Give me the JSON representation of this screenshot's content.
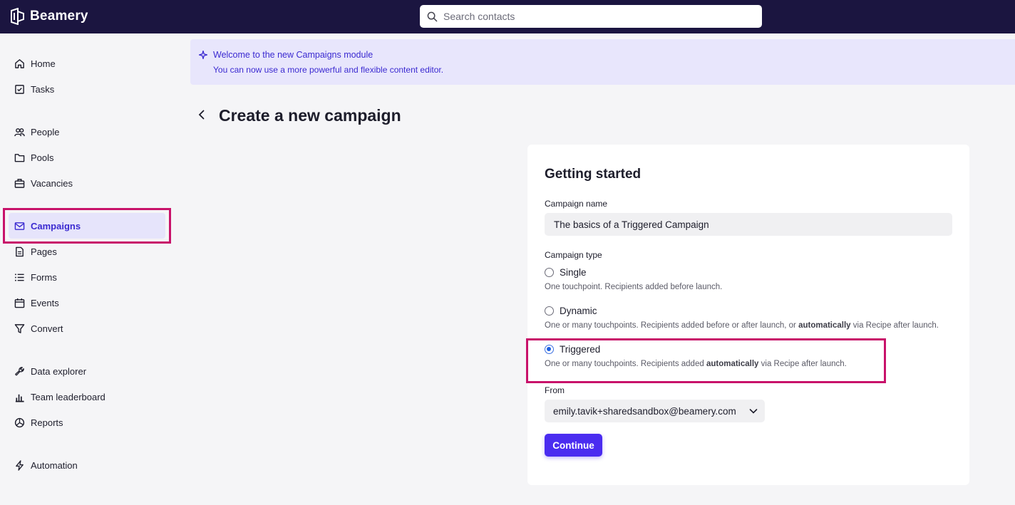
{
  "app": {
    "brand_name": "Beamery"
  },
  "search": {
    "placeholder": "Search contacts"
  },
  "sidebar": {
    "items": [
      {
        "label": "Home",
        "icon": "home-icon"
      },
      {
        "label": "Tasks",
        "icon": "tasks-icon"
      },
      {
        "label": "People",
        "icon": "people-icon"
      },
      {
        "label": "Pools",
        "icon": "folder-icon"
      },
      {
        "label": "Vacancies",
        "icon": "briefcase-icon"
      },
      {
        "label": "Campaigns",
        "icon": "mail-icon",
        "active": true
      },
      {
        "label": "Pages",
        "icon": "page-icon"
      },
      {
        "label": "Forms",
        "icon": "list-icon"
      },
      {
        "label": "Events",
        "icon": "calendar-icon"
      },
      {
        "label": "Convert",
        "icon": "filter-icon"
      },
      {
        "label": "Data explorer",
        "icon": "wrench-icon"
      },
      {
        "label": "Team leaderboard",
        "icon": "bar-chart-icon"
      },
      {
        "label": "Reports",
        "icon": "pie-chart-icon"
      },
      {
        "label": "Automation",
        "icon": "lightning-icon"
      }
    ]
  },
  "banner": {
    "title": "Welcome to the new Campaigns module",
    "text": "You can now use a more powerful and flexible content editor."
  },
  "page": {
    "title": "Create a new campaign"
  },
  "form": {
    "heading": "Getting started",
    "campaign_name_label": "Campaign name",
    "campaign_name_value": "The basics of a Triggered Campaign",
    "campaign_type_label": "Campaign type",
    "types": [
      {
        "label": "Single",
        "desc_parts": [
          "One touchpoint. Recipients added before launch."
        ],
        "checked": false
      },
      {
        "label": "Dynamic",
        "desc_parts": [
          "One or many touchpoints. Recipients added before or after launch, or ",
          "automatically",
          " via Recipe after launch."
        ],
        "checked": false
      },
      {
        "label": "Triggered",
        "desc_parts": [
          "One or many touchpoints. Recipients added ",
          "automatically",
          " via Recipe after launch."
        ],
        "checked": true
      }
    ],
    "from_label": "From",
    "from_value": "emily.tavik+sharedsandbox@beamery.com",
    "continue_label": "Continue"
  },
  "colors": {
    "topbar": "#1b1540",
    "accent": "#4a2cf0",
    "highlight": "#c8126a"
  }
}
